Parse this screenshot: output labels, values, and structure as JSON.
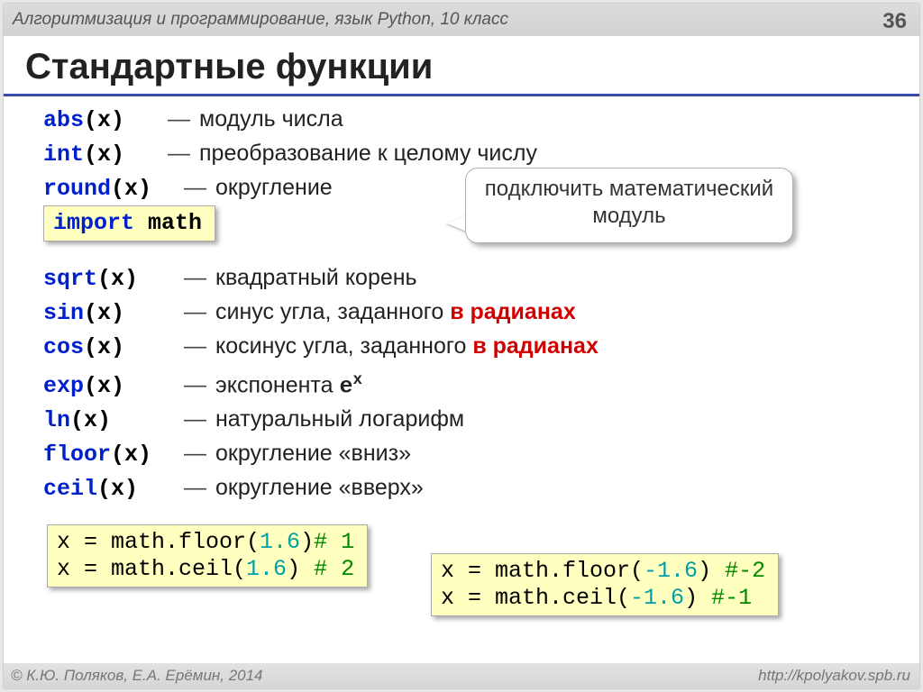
{
  "header": {
    "course": "Алгоритмизация и программирование, язык Python, 10 класс",
    "page": "36"
  },
  "title": "Стандартные функции",
  "builtin": [
    {
      "fn": "abs",
      "arg": "(x)",
      "desc": "модуль числа"
    },
    {
      "fn": "int",
      "arg": "(x)",
      "desc": "преобразование к целому числу"
    },
    {
      "fn": "round",
      "arg": "(x)",
      "desc": "округление"
    }
  ],
  "import_line": {
    "kw": "import",
    "mod": "math"
  },
  "callout": "подключить математический модуль",
  "mathfns": [
    {
      "fn": "sqrt",
      "arg": "(x)",
      "desc": "квадратный корень"
    },
    {
      "fn": "sin",
      "arg": "(x)",
      "desc": "синус угла, заданного ",
      "red": "в радианах"
    },
    {
      "fn": "cos",
      "arg": "(x)",
      "desc": "косинус угла, заданного ",
      "red": "в радианах"
    },
    {
      "fn": "exp",
      "arg": "(x)",
      "desc": "экспонента ",
      "tail_mono": "e",
      "sup": "x"
    },
    {
      "fn": "ln",
      "arg": "(x)",
      "desc": "натуральный логарифм"
    },
    {
      "fn": "floor",
      "arg": "(x)",
      "desc": "округление «вниз»"
    },
    {
      "fn": "ceil",
      "arg": "(x)",
      "desc": "округление «вверх»"
    }
  ],
  "ex_left": {
    "l1": {
      "pre": "x = math.floor(",
      "num": "1.6",
      "post": ")",
      "comment": "# 1"
    },
    "l2": {
      "pre": "x = math.ceil(",
      "num": "1.6",
      "post": ") ",
      "comment": "# 2"
    }
  },
  "ex_right": {
    "l1": {
      "pre": "x = math.floor(",
      "num": "-1.6",
      "post": ") ",
      "comment": "#-2"
    },
    "l2": {
      "pre": "x = math.ceil(",
      "num": "-1.6",
      "post": ")  ",
      "comment": "#-1"
    }
  },
  "footer": {
    "left": "© К.Ю. Поляков, Е.А. Ерёмин, 2014",
    "right": "http://kpolyakov.spb.ru"
  },
  "dash": "—"
}
